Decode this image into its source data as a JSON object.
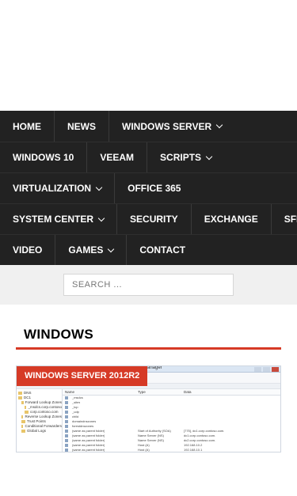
{
  "nav": {
    "rows": [
      [
        {
          "label": "HOME",
          "caret": false
        },
        {
          "label": "NEWS",
          "caret": false
        },
        {
          "label": "WINDOWS SERVER",
          "caret": true
        }
      ],
      [
        {
          "label": "WINDOWS 10",
          "caret": false
        },
        {
          "label": "VEEAM",
          "caret": false
        },
        {
          "label": "SCRIPTS",
          "caret": true
        }
      ],
      [
        {
          "label": "VIRTUALIZATION",
          "caret": true
        },
        {
          "label": "OFFICE 365",
          "caret": false
        }
      ],
      [
        {
          "label": "SYSTEM CENTER",
          "caret": true
        },
        {
          "label": "SECURITY",
          "caret": false
        },
        {
          "label": "EXCHANGE",
          "caret": false
        },
        {
          "label": "SFB",
          "caret": false
        }
      ],
      [
        {
          "label": "VIDEO",
          "caret": false
        },
        {
          "label": "GAMES",
          "caret": true
        },
        {
          "label": "CONTACT",
          "caret": false
        }
      ]
    ]
  },
  "search": {
    "placeholder": "SEARCH ..."
  },
  "section": {
    "title": "WINDOWS"
  },
  "post": {
    "category": "WINDOWS SERVER 2012R2",
    "thumbnail": {
      "window_title": "Manager",
      "tree": [
        {
          "label": "DNS",
          "level": 0
        },
        {
          "label": "DC1",
          "level": 0
        },
        {
          "label": "Forward Lookup Zones",
          "level": 1
        },
        {
          "label": "_msdcs.corp.contoso",
          "level": 2
        },
        {
          "label": "corp.contoso.com",
          "level": 2
        },
        {
          "label": "Reverse Lookup Zones",
          "level": 1
        },
        {
          "label": "Trust Points",
          "level": 1
        },
        {
          "label": "Conditional Forwarders",
          "level": 1
        },
        {
          "label": "Global Logs",
          "level": 1
        }
      ],
      "columns": [
        "Name",
        "Type",
        "Data"
      ],
      "rows": [
        [
          "_msdcs",
          "",
          ""
        ],
        [
          "_sites",
          "",
          ""
        ],
        [
          "_tcp",
          "",
          ""
        ],
        [
          "_udp",
          "",
          ""
        ],
        [
          "child",
          "",
          ""
        ],
        [
          "domaindnszones",
          "",
          ""
        ],
        [
          "forestdnszones",
          "",
          ""
        ],
        [
          "(same as parent folder)",
          "Start of Authority (SOA)",
          "[775], dc1.corp.contoso.com."
        ],
        [
          "(same as parent folder)",
          "Name Server (NS)",
          "dc1.corp.contoso.com."
        ],
        [
          "(same as parent folder)",
          "Name Server (NS)",
          "dc2.corp.contoso.com."
        ],
        [
          "(same as parent folder)",
          "Host (A)",
          "192.168.10.2"
        ],
        [
          "(same as parent folder)",
          "Host (A)",
          "192.168.10.1"
        ]
      ]
    }
  }
}
